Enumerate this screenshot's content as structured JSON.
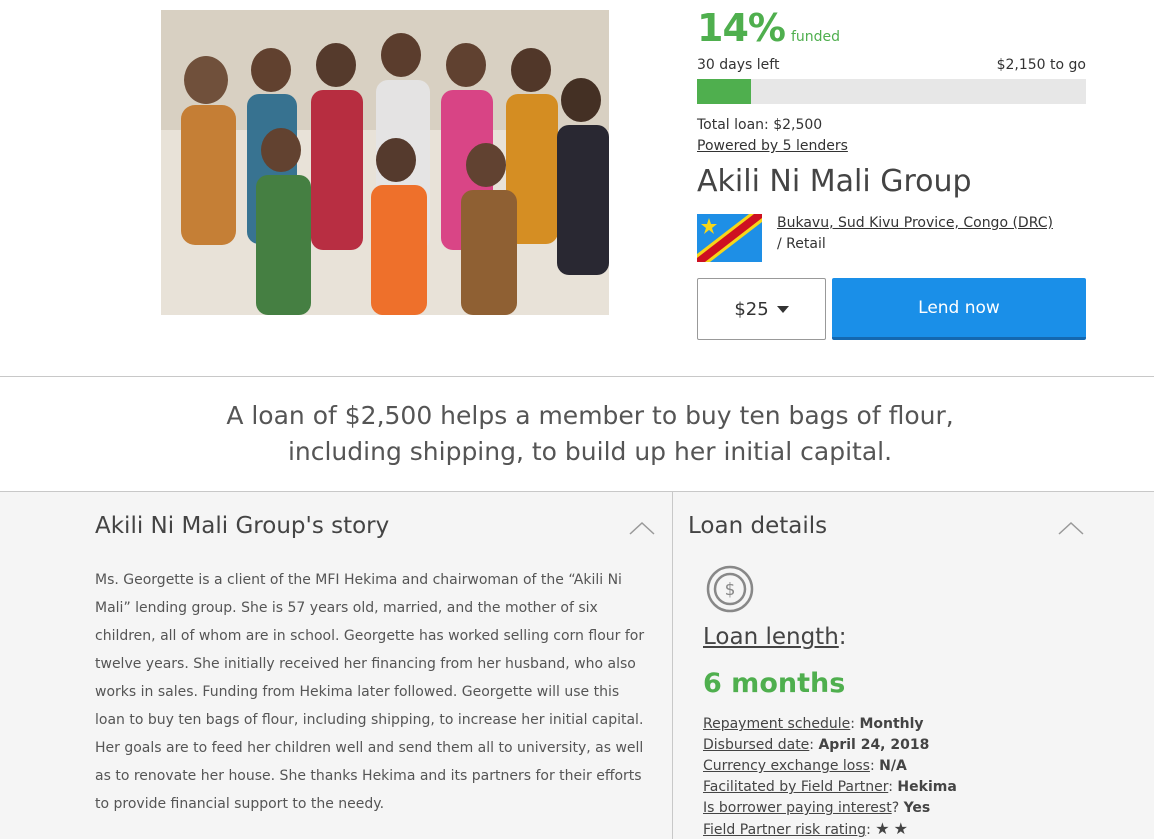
{
  "funding": {
    "percent": "14%",
    "funded_label": "funded",
    "days_left": "30 days left",
    "to_go": "$2,150 to go",
    "progress_fraction": 0.14,
    "total_loan": "Total loan: $2,500",
    "lenders": "Powered by 5 lenders"
  },
  "borrower": {
    "name": "Akili Ni Mali Group",
    "location": "Bukavu, Sud Kivu Provice, Congo (DRC)",
    "sector": "/ Retail"
  },
  "lend": {
    "amount": "$25",
    "button_label": "Lend now"
  },
  "loan_use": {
    "line1": "A loan of $2,500 helps a member to buy ten bags of flour,",
    "line2": "including shipping, to build up her initial capital."
  },
  "story": {
    "title": "Akili Ni Mali Group's story",
    "text": "Ms. Georgette is a client of the MFI Hekima and chairwoman of the “Akili Ni Mali” lending group. She is 57 years old, married, and the mother of six children, all of whom are in school. Georgette has worked selling corn flour for twelve years. She initially received her financing from her husband, who also works in sales. Funding from Hekima later followed. Georgette will use this loan to buy ten bags of flour, including shipping, to increase her initial capital. Her goals are to feed her children well and send them all to university, as well as to renovate her house. She thanks Hekima and its partners for their efforts to provide financial support to the needy."
  },
  "details": {
    "title": "Loan details",
    "loan_length_label": "Loan length",
    "loan_length_value": "6 months",
    "repayment_label": "Repayment schedule",
    "repayment_value": "Monthly",
    "disbursed_label": "Disbursed date",
    "disbursed_value": "April 24, 2018",
    "fx_label": "Currency exchange loss",
    "fx_value": "N/A",
    "partner_label": "Facilitated by Field Partner",
    "partner_value": "Hekima",
    "interest_label": "Is borrower paying interest",
    "interest_value": "Yes",
    "risk_label": "Field Partner risk rating",
    "risk_stars": "★★"
  },
  "icons": {
    "flag": "drc-flag-icon",
    "collapse": "chevron-up-icon",
    "money": "money-cycle-icon",
    "caret": "caret-down-icon"
  },
  "colors": {
    "funded_green": "#4faf4e",
    "lend_blue": "#1a8fe8"
  }
}
